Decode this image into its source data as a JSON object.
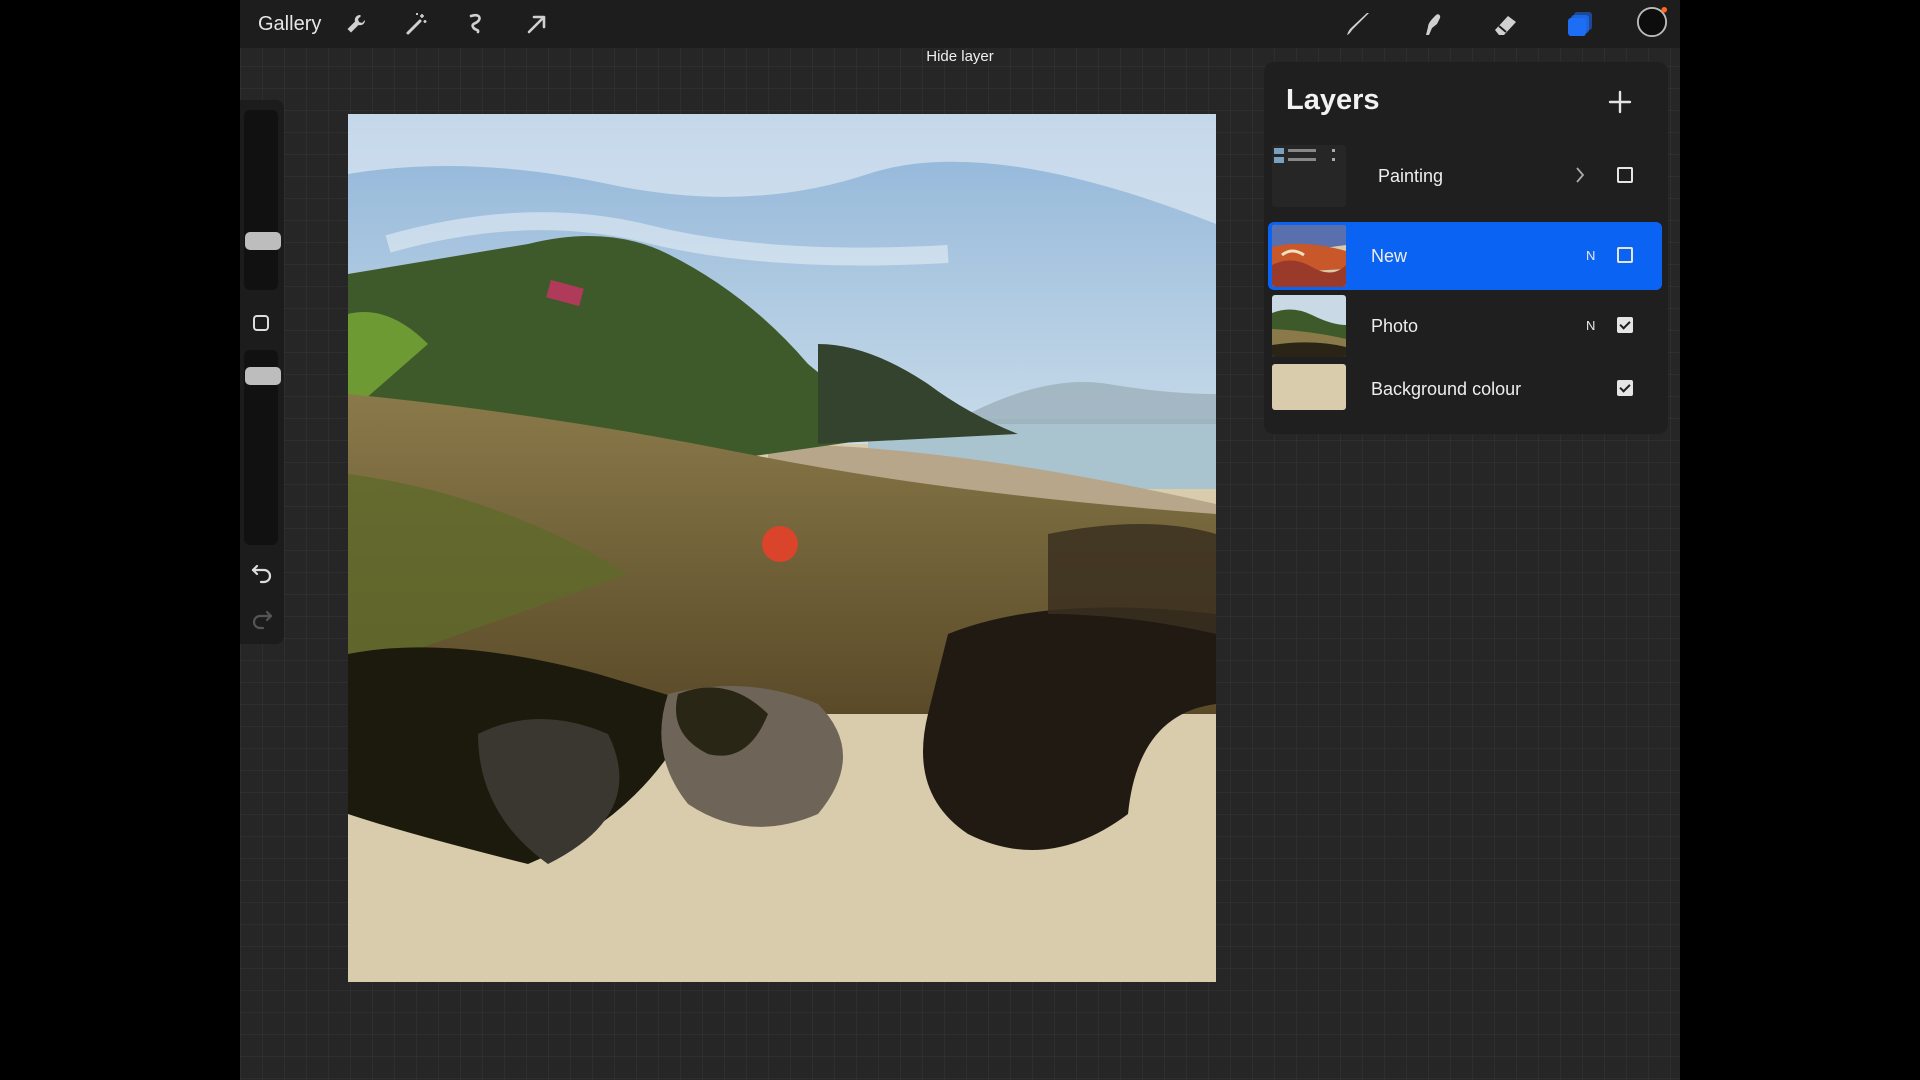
{
  "topbar": {
    "gallery_label": "Gallery",
    "left_tools": [
      "wrench-icon",
      "magic-wand-icon",
      "selection-icon",
      "transform-arrow-icon"
    ],
    "right_tools": [
      "brush-icon",
      "smudge-icon",
      "eraser-icon",
      "layers-icon",
      "color-swatch"
    ],
    "current_color": "#0d0d0d",
    "layers_icon_color": "#1e6df5"
  },
  "hint": "Hide layer",
  "layers_panel": {
    "title": "Layers",
    "items": [
      {
        "name": "Painting",
        "blend": "",
        "visible": false,
        "group": true,
        "selected": false
      },
      {
        "name": "New",
        "blend": "N",
        "visible": false,
        "group": false,
        "selected": true
      },
      {
        "name": "Photo",
        "blend": "N",
        "visible": true,
        "group": false,
        "selected": false
      },
      {
        "name": "Background colour",
        "blend": "",
        "visible": true,
        "group": false,
        "selected": false
      }
    ]
  },
  "colors": {
    "selected_row": "#0b63f3",
    "background_colour": "#d8ccac"
  }
}
